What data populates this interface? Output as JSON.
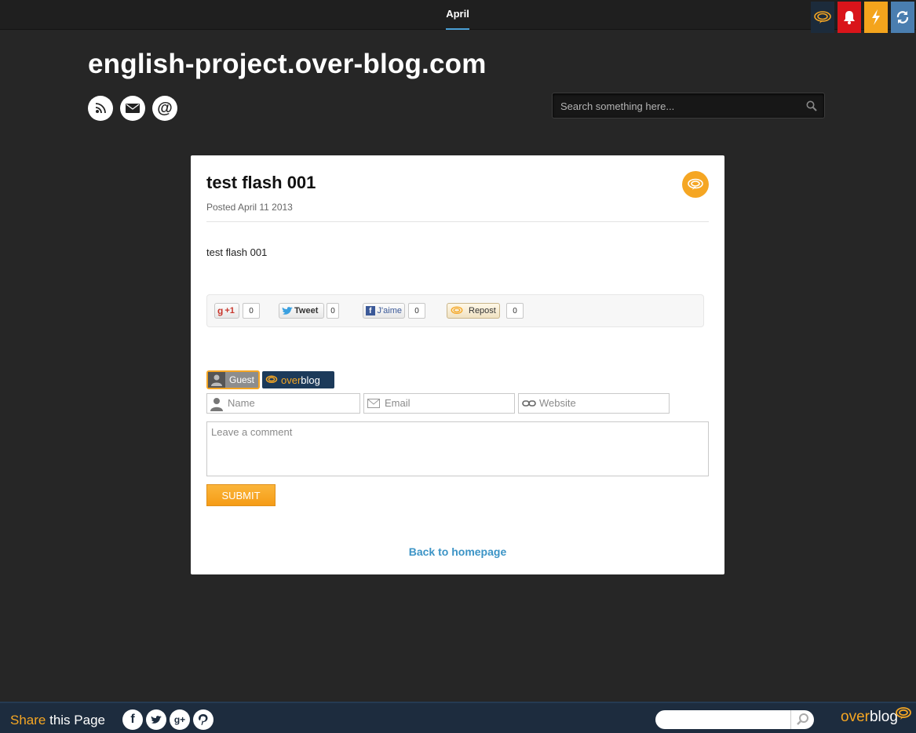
{
  "nav": {
    "current": "April"
  },
  "toolbar": {
    "icons": [
      "overblog-icon",
      "bell-icon",
      "flash-icon",
      "sync-icon"
    ],
    "colors": {
      "overblog": "#1c2b3b",
      "bell": "#d9141a",
      "flash": "#f4a41c",
      "sync": "#4a7eb0"
    }
  },
  "header": {
    "site_title": "english-project.over-blog.com",
    "social_icons": [
      "rss-icon",
      "mail-icon",
      "at-icon"
    ],
    "at_symbol": "@",
    "search_placeholder": "Search something here..."
  },
  "post": {
    "title": "test flash 001",
    "meta": "Posted April 11 2013",
    "body": "test flash 001",
    "share": {
      "gplus_label": "+1",
      "gplus_count": "0",
      "tweet_label": "Tweet",
      "tweet_count": "0",
      "fb_label": "J'aime",
      "fb_count": "0",
      "repost_label": "Repost",
      "repost_count": "0"
    }
  },
  "comment_form": {
    "guest_label": "Guest",
    "overblog_label_1": "over",
    "overblog_label_2": "blog",
    "name_placeholder": "Name",
    "email_placeholder": "Email",
    "website_placeholder": "Website",
    "comment_placeholder": "Leave a comment",
    "submit_label": "SUBMIT"
  },
  "back_link": "Back to homepage",
  "footer": {
    "share_hl": "Share",
    "share_rest": " this Page",
    "social": {
      "fb": "f",
      "gplus": "g+"
    },
    "logo_1": "over",
    "logo_2": "blog"
  },
  "accent_color": "#f5a623",
  "link_color": "#3c94c6"
}
